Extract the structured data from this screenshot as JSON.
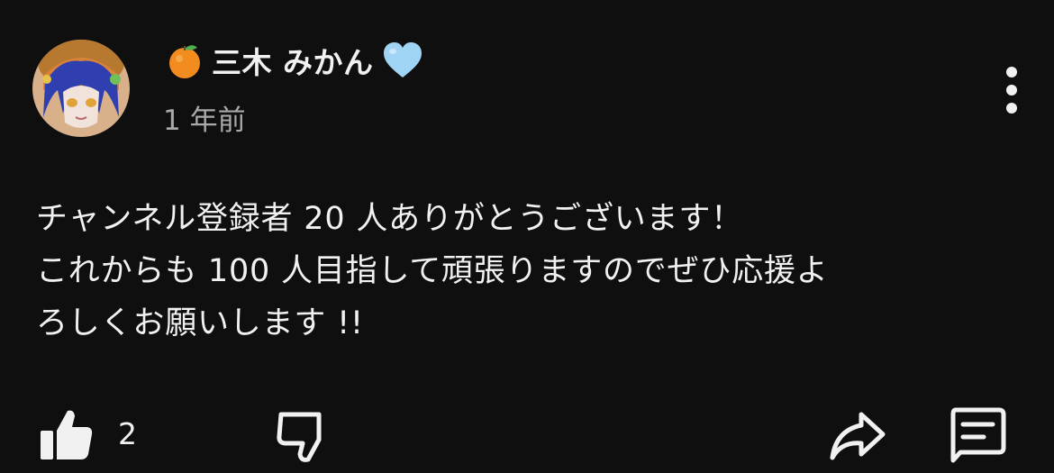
{
  "author": {
    "prefix_emoji_icon": "tangerine-icon",
    "name": "三木 みかん",
    "suffix_emoji_icon": "light-blue-heart-icon"
  },
  "post": {
    "timestamp": "1 年前",
    "lines": [
      "チャンネル登録者 20 人ありがとうございます！",
      "これからも 100 人目指して頑張りますのでぜひ応援よ",
      "ろしくお願いします !!"
    ]
  },
  "actions": {
    "like_icon": "thumbs-up-icon",
    "like_count": "2",
    "dislike_icon": "thumbs-down-icon",
    "share_icon": "share-icon",
    "reply_icon": "comment-icon",
    "menu_icon": "more-vertical-icon"
  },
  "colors": {
    "background": "#0f0f0f",
    "text": "#f1f1f1",
    "secondary_text": "#aaaaaa",
    "heart": "#9fd4f5",
    "tangerine": "#f28c1e"
  }
}
